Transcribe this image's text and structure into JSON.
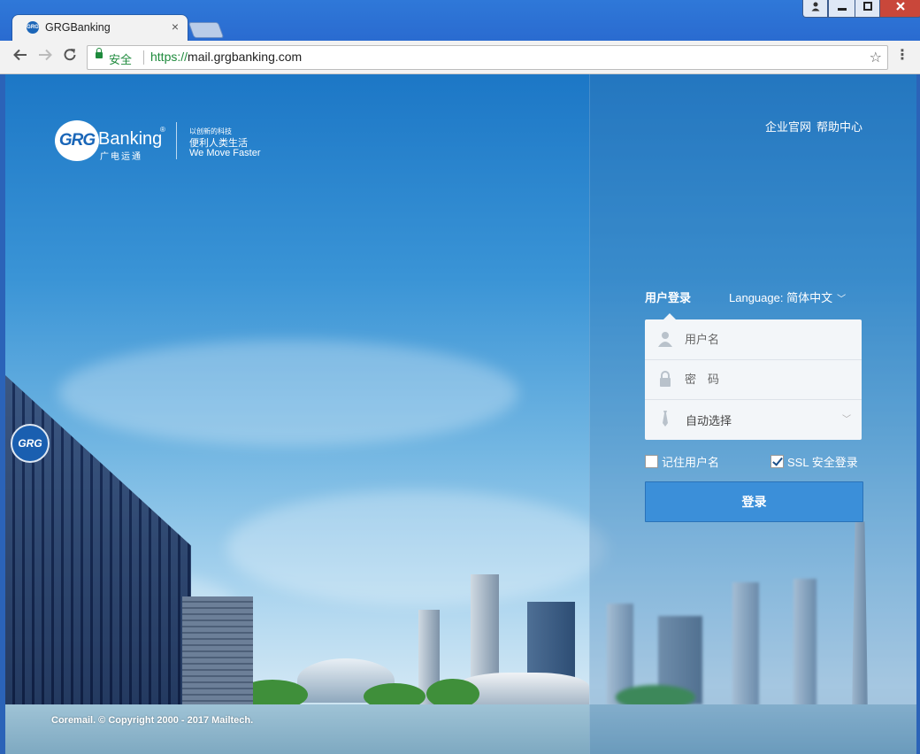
{
  "browser": {
    "tab_title": "GRGBanking",
    "favicon_text": "GRG",
    "tab_close": "×",
    "secure_label": "安全",
    "url_scheme": "https://",
    "url_host": "mail.grgbanking.com",
    "icons": [
      "back-icon",
      "forward-icon",
      "reload-icon",
      "lock-icon",
      "star-icon",
      "menu-icon",
      "user-icon",
      "minimize-icon",
      "maximize-icon",
      "close-icon"
    ]
  },
  "brand": {
    "logo_mark": "GRG",
    "logo_word": "Banking",
    "logo_reg": "®",
    "logo_sub": "广电运通",
    "slogan_1": "以创新的科技",
    "slogan_2": "便利人类生活",
    "slogan_3": "We Move Faster",
    "building_logo": "GRG"
  },
  "top_links": {
    "company_site": "企业官网",
    "help_center": "帮助中心"
  },
  "login": {
    "tab_label": "用户登录",
    "language_label": "Language: 简体中文",
    "username_placeholder": "用户名",
    "password_placeholder": "密　码",
    "domain_select": "自动选择",
    "remember_label": "记住用户名",
    "remember_checked": false,
    "ssl_label": "SSL 安全登录",
    "ssl_checked": true,
    "submit_label": "登录"
  },
  "footer": {
    "copyright": "Coremail. © Copyright 2000 - 2017 Mailtech."
  },
  "colors": {
    "accent": "#3b8fd9",
    "secure_green": "#1e8a3c",
    "brand_blue": "#1a66b8"
  }
}
